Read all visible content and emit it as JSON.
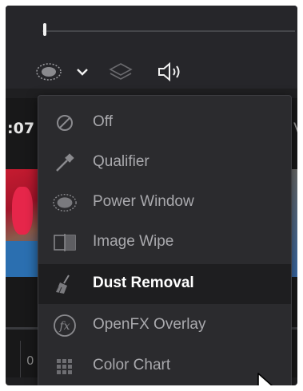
{
  "viewer": {
    "timecode": ":07",
    "right_edge_letter": "V",
    "lower_number": "0"
  },
  "toolbar": {
    "icons": [
      "power-window-icon",
      "chevron-down-icon",
      "layers-icon",
      "speaker-icon"
    ]
  },
  "overlay_menu": {
    "items": [
      {
        "label": "Off",
        "icon": "off-icon"
      },
      {
        "label": "Qualifier",
        "icon": "eyedropper-icon"
      },
      {
        "label": "Power Window",
        "icon": "power-window-icon"
      },
      {
        "label": "Image Wipe",
        "icon": "image-wipe-icon"
      },
      {
        "label": "Dust Removal",
        "icon": "brush-icon",
        "selected": true
      },
      {
        "label": "OpenFX Overlay",
        "icon": "fx-icon"
      },
      {
        "label": "Color Chart",
        "icon": "color-chart-icon"
      }
    ]
  },
  "colors": {
    "menu_background": "#2b2b2e",
    "selected_row": "#1e1e20",
    "item_text": "#a9a9ad",
    "selected_text": "#ffffff"
  }
}
